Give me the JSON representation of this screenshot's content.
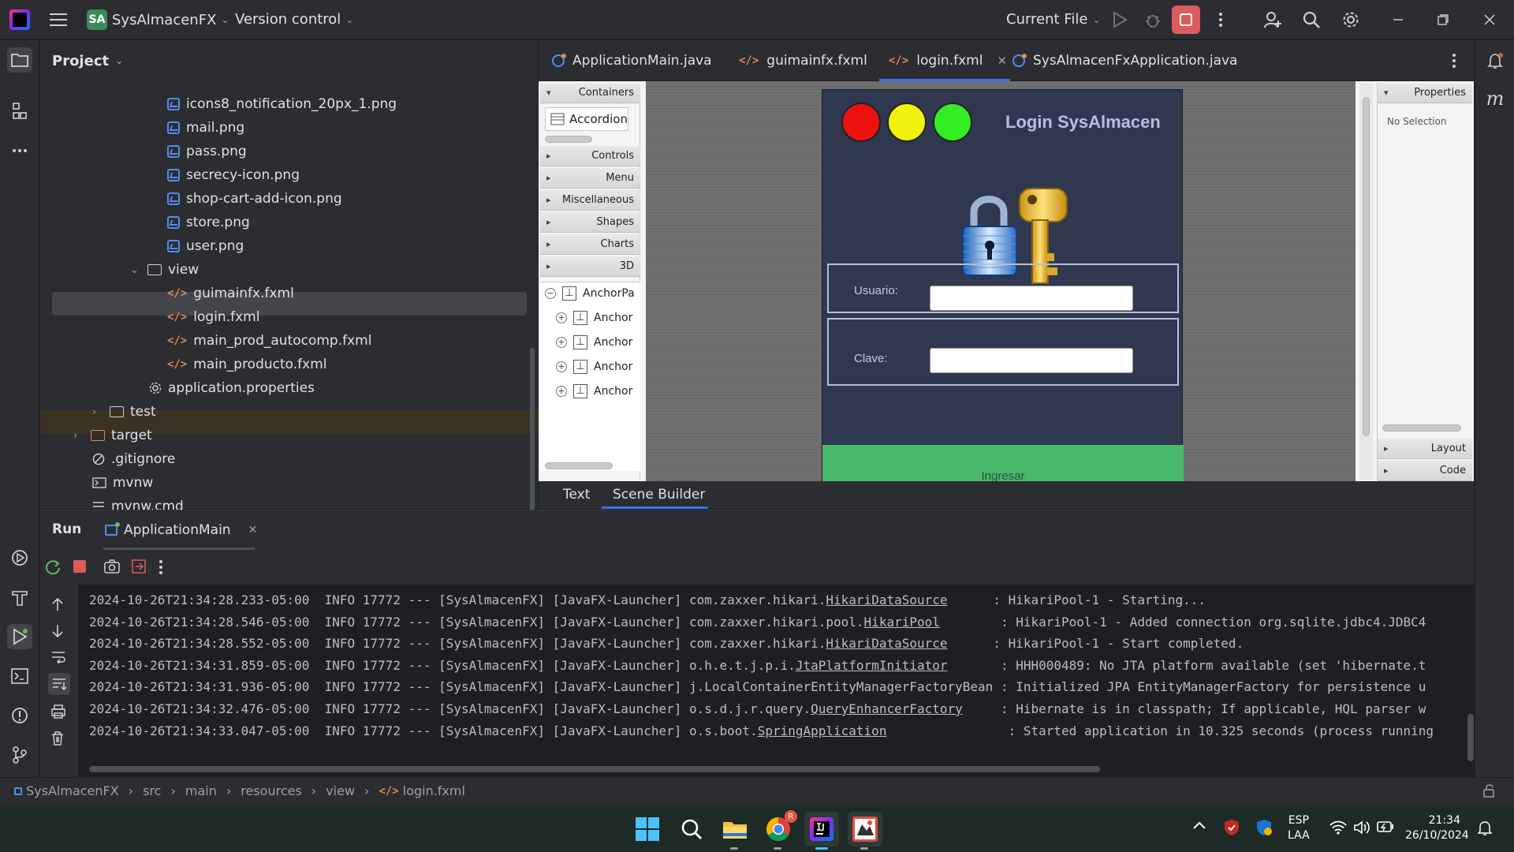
{
  "titlebar": {
    "project_badge": "SA",
    "project_name": "SysAlmacenFX",
    "version_control": "Version control",
    "run_config": "Current File"
  },
  "project_panel": {
    "title": "Project",
    "items": [
      {
        "label": "icons8_notification_20px_1.png",
        "type": "image"
      },
      {
        "label": "mail.png",
        "type": "image"
      },
      {
        "label": "pass.png",
        "type": "image"
      },
      {
        "label": "secrecy-icon.png",
        "type": "image"
      },
      {
        "label": "shop-cart-add-icon.png",
        "type": "image"
      },
      {
        "label": "store.png",
        "type": "image"
      },
      {
        "label": "user.png",
        "type": "image"
      },
      {
        "label": "view",
        "type": "folder"
      },
      {
        "label": "guimainfx.fxml",
        "type": "fxml"
      },
      {
        "label": "login.fxml",
        "type": "fxml"
      },
      {
        "label": "main_prod_autocomp.fxml",
        "type": "fxml"
      },
      {
        "label": "main_producto.fxml",
        "type": "fxml"
      },
      {
        "label": "application.properties",
        "type": "settings"
      },
      {
        "label": "test",
        "type": "folder"
      },
      {
        "label": "target",
        "type": "folder"
      },
      {
        "label": ".gitignore",
        "type": "ignore"
      },
      {
        "label": "mvnw",
        "type": "terminal"
      },
      {
        "label": "mvnw.cmd",
        "type": "text"
      }
    ]
  },
  "editor_tabs": [
    {
      "label": "ApplicationMain.java"
    },
    {
      "label": "guimainfx.fxml"
    },
    {
      "label": "login.fxml"
    },
    {
      "label": "SysAlmacenFxApplication.java"
    }
  ],
  "scene_builder": {
    "library_sections": [
      "Containers",
      "Controls",
      "Menu",
      "Miscellaneous",
      "Shapes",
      "Charts",
      "3D"
    ],
    "accordion_item": "Accordion",
    "hierarchy": [
      "AnchorPa",
      "Anchor",
      "Anchor",
      "Anchor",
      "Anchor"
    ],
    "properties_title": "Properties",
    "no_selection": "No Selection",
    "layout_label": "Layout",
    "code_label": "Code"
  },
  "login_form": {
    "title": "Login SysAlmacen",
    "usuario_label": "Usuario:",
    "clave_label": "Clave:",
    "button": "Ingresar",
    "colors": {
      "bg": "#303850",
      "button": "#48b86a",
      "red": "#ee1111",
      "yellow": "#f2f20e",
      "green": "#33ee22"
    }
  },
  "editor_bottom_tabs": [
    {
      "label": "Text"
    },
    {
      "label": "Scene Builder"
    }
  ],
  "run_panel": {
    "title": "Run",
    "tab": "ApplicationMain",
    "log": [
      {
        "prefix": "2024-10-26T21:34:28.233-05:00  INFO 17772 --- [SysAlmacenFX] [JavaFX-Launcher] com.zaxxer.hikari.",
        "cls": "HikariDataSource",
        "suffix": "      : HikariPool-1 - Starting..."
      },
      {
        "prefix": "2024-10-26T21:34:28.546-05:00  INFO 17772 --- [SysAlmacenFX] [JavaFX-Launcher] com.zaxxer.hikari.pool.",
        "cls": "HikariPool",
        "suffix": "        : HikariPool-1 - Added connection org.sqlite.jdbc4.JDBC4"
      },
      {
        "prefix": "2024-10-26T21:34:28.552-05:00  INFO 17772 --- [SysAlmacenFX] [JavaFX-Launcher] com.zaxxer.hikari.",
        "cls": "HikariDataSource",
        "suffix": "      : HikariPool-1 - Start completed."
      },
      {
        "prefix": "2024-10-26T21:34:31.859-05:00  INFO 17772 --- [SysAlmacenFX] [JavaFX-Launcher] o.h.e.t.j.p.i.",
        "cls": "JtaPlatformInitiator",
        "suffix": "       : HHH000489: No JTA platform available (set 'hibernate.t"
      },
      {
        "prefix": "2024-10-26T21:34:31.936-05:00  INFO 17772 --- [SysAlmacenFX] [JavaFX-Launcher] j.LocalContainerEntityManagerFactoryBean",
        "cls": "",
        "suffix": " : Initialized JPA EntityManagerFactory for persistence u"
      },
      {
        "prefix": "2024-10-26T21:34:32.476-05:00  INFO 17772 --- [SysAlmacenFX] [JavaFX-Launcher] o.s.d.j.r.query.",
        "cls": "QueryEnhancerFactory",
        "suffix": "     : Hibernate is in classpath; If applicable, HQL parser w"
      },
      {
        "prefix": "2024-10-26T21:34:33.047-05:00  INFO 17772 --- [SysAlmacenFX] [JavaFX-Launcher] o.s.boot.",
        "cls": "SpringApplication",
        "suffix": "                : Started application in 10.325 seconds (process running"
      }
    ]
  },
  "breadcrumb": [
    "SysAlmacenFX",
    "src",
    "main",
    "resources",
    "view",
    "login.fxml"
  ],
  "taskbar": {
    "lang_top": "ESP",
    "lang_bottom": "LAA",
    "time": "21:34",
    "date": "26/10/2024",
    "chrome_badge": "R"
  }
}
